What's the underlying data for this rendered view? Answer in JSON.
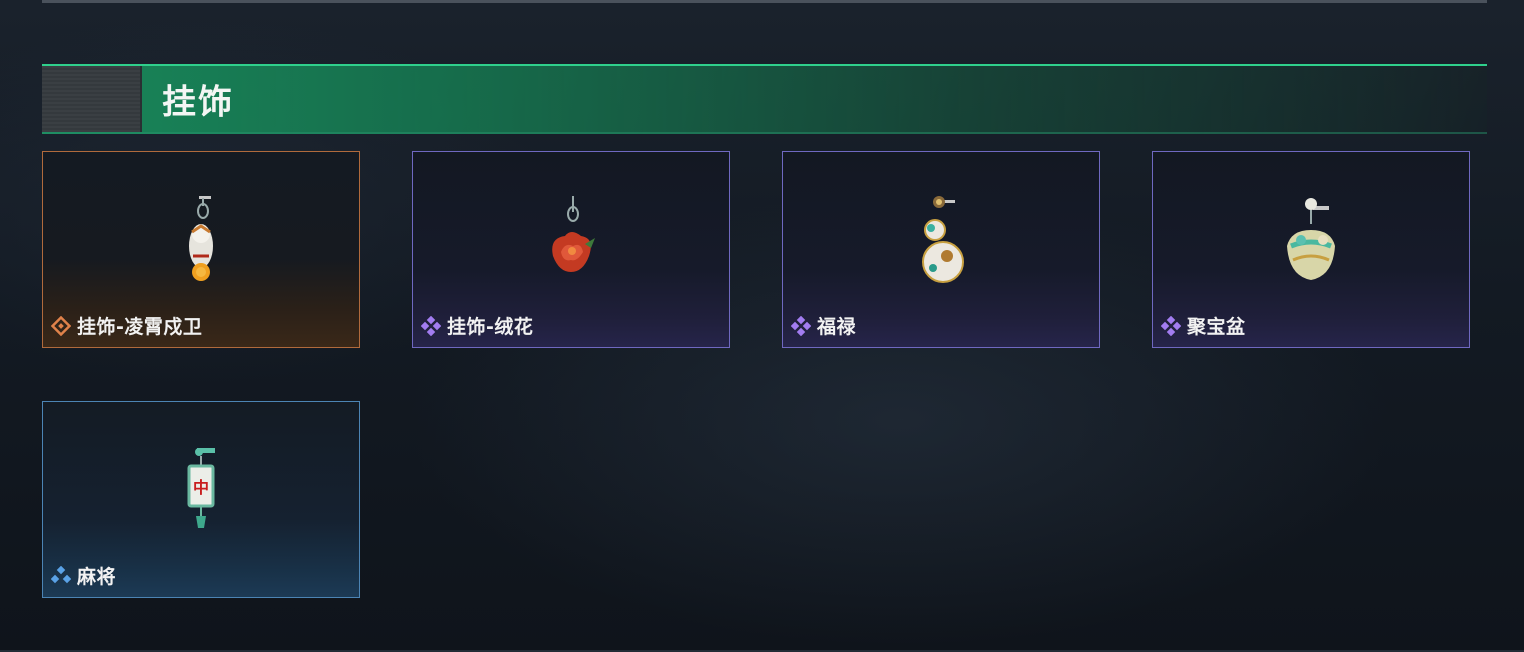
{
  "section": {
    "title": "挂饰"
  },
  "items": [
    {
      "name": "挂饰-凌霄戍卫",
      "rarity": "orange",
      "rarity_color": "#e0824a",
      "icon": "guardian-charm-icon"
    },
    {
      "name": "挂饰-绒花",
      "rarity": "purple",
      "rarity_color": "#a27cf0",
      "icon": "rose-charm-icon"
    },
    {
      "name": "福禄",
      "rarity": "purple",
      "rarity_color": "#a27cf0",
      "icon": "gourd-charm-icon"
    },
    {
      "name": "聚宝盆",
      "rarity": "purple",
      "rarity_color": "#a27cf0",
      "icon": "treasure-bowl-charm-icon"
    },
    {
      "name": "麻将",
      "rarity": "blue",
      "rarity_color": "#5aa2e6",
      "icon": "mahjong-charm-icon",
      "tile_char": "中"
    }
  ],
  "colors": {
    "header_accent": "#2fd08c",
    "orange_border": "#b06a3c",
    "purple_border": "#6f68c0",
    "blue_border": "#4c84b4"
  }
}
